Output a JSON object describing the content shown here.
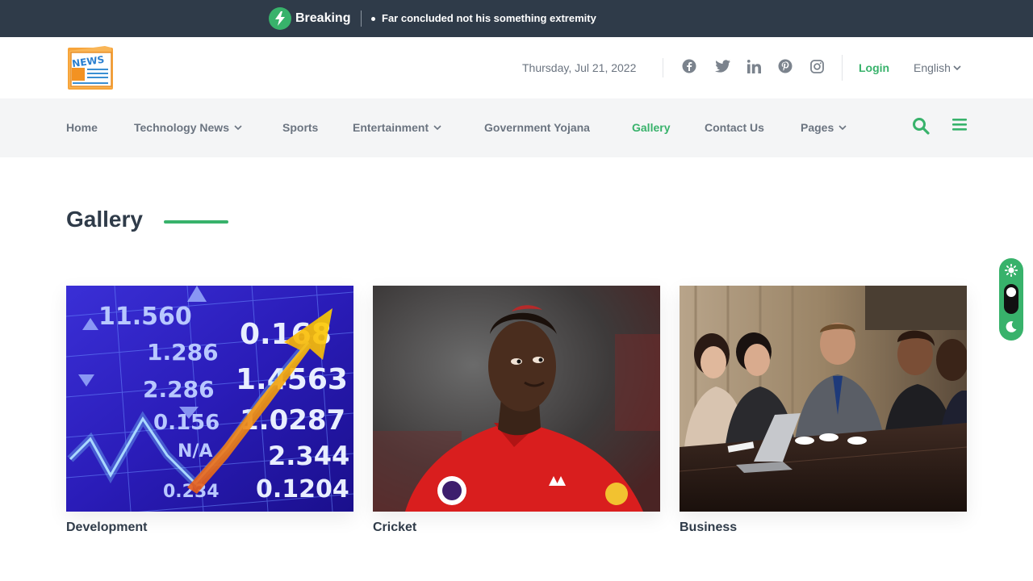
{
  "breaking": {
    "label": "Breaking",
    "headline": "Far concluded not his something extremity"
  },
  "header": {
    "logo_text": "NEWS",
    "date": "Thursday, Jul 21, 2022",
    "social_icons": [
      "facebook-icon",
      "twitter-icon",
      "linkedin-icon",
      "pinterest-icon",
      "instagram-icon"
    ],
    "login": "Login",
    "language": "English"
  },
  "nav": {
    "items": [
      {
        "label": "Home",
        "dropdown": false
      },
      {
        "label": "Technology News",
        "dropdown": true
      },
      {
        "label": "Sports",
        "dropdown": false
      },
      {
        "label": "Entertainment",
        "dropdown": true
      },
      {
        "label": "Government Yojana",
        "dropdown": false
      },
      {
        "label": "Gallery",
        "dropdown": false,
        "active": true
      },
      {
        "label": "Contact Us",
        "dropdown": false
      },
      {
        "label": "Pages",
        "dropdown": true
      }
    ]
  },
  "gallery": {
    "title": "Gallery",
    "cards": [
      {
        "caption": "Development",
        "image": "stock-market-chart-image"
      },
      {
        "caption": "Cricket",
        "image": "football-player-image"
      },
      {
        "caption": "Business",
        "image": "business-meeting-image"
      }
    ],
    "stock_numbers": [
      "11.560",
      "1.286",
      "2.286",
      "0.156",
      "0.168",
      "1.4563",
      "1.0287",
      "2.344",
      "0.1204",
      "0.234",
      "N/A"
    ]
  },
  "colors": {
    "accent": "#38b26b",
    "dark": "#2f3b49",
    "muted": "#6b7480",
    "nav_bg": "#f4f5f6"
  }
}
